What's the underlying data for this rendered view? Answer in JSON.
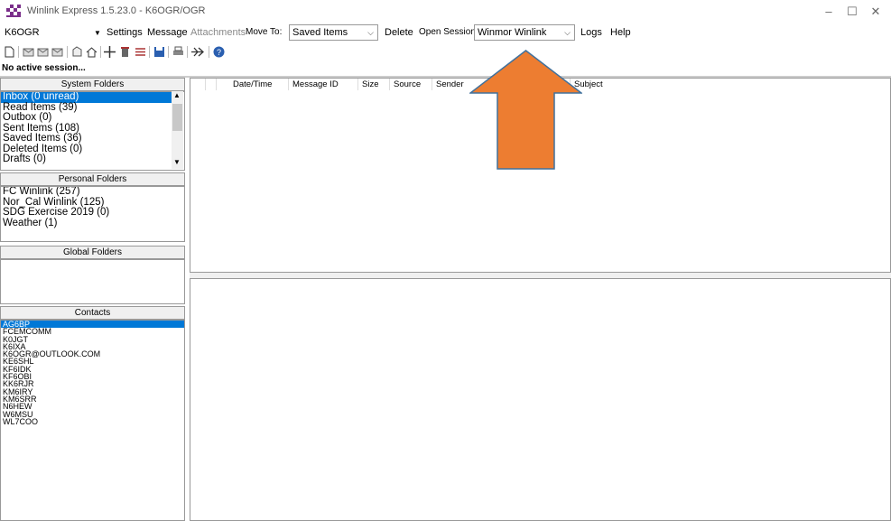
{
  "window": {
    "title": "Winlink Express 1.5.23.0 - K6OGR/OGR",
    "minimize_glyph": "–",
    "maximize_glyph": "☐",
    "close_glyph": "✕"
  },
  "menubar": {
    "callsign": "K6OGR",
    "settings": "Settings",
    "message": "Message",
    "attachments": "Attachments",
    "move_to": "Move To:",
    "move_to_value": "Saved Items",
    "delete": "Delete",
    "open_session": "Open Session:",
    "session_value": "Winmor Winlink",
    "logs": "Logs",
    "help": "Help"
  },
  "status": "No active session...",
  "system_folders": {
    "header": "System Folders",
    "items": [
      "Inbox (0 unread)",
      "Read Items (39)",
      "Outbox (0)",
      "Sent Items (108)",
      "Saved Items (36)",
      "Deleted Items (0)",
      "Drafts (0)"
    ]
  },
  "personal_folders": {
    "header": "Personal Folders",
    "items": [
      "FC Winlink (257)",
      "Nor_Cal Winlink (125)",
      "SDG Exercise 2019 (0)",
      "Weather (1)"
    ]
  },
  "global_folders": {
    "header": "Global Folders"
  },
  "contacts": {
    "header": "Contacts",
    "items": [
      "AG6BP",
      "FCEMCOMM",
      "K0JGT",
      "K6IXA",
      "K6OGR@OUTLOOK.COM",
      "KE6SHL",
      "KF6IDK",
      "KF6OBI",
      "KK6RJR",
      "KM6IRY",
      "KM6SRR",
      "N6HEW",
      "W6MSU",
      "WL7COO"
    ]
  },
  "message_list": {
    "columns": [
      "Date/Time",
      "Message ID",
      "Size",
      "Source",
      "Sender",
      "Subject"
    ]
  },
  "colors": {
    "selection": "#0078d7",
    "annotation_arrow": "#ed7d31",
    "annotation_arrow_stroke": "#41719c"
  }
}
